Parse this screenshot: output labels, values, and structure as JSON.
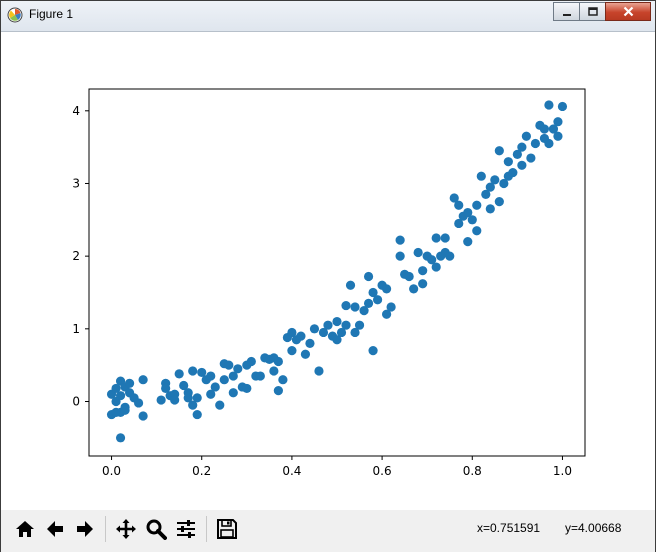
{
  "window": {
    "title": "Figure 1"
  },
  "toolbar": {
    "buttons": [
      "home-icon",
      "back-icon",
      "forward-icon",
      "pan-icon",
      "zoom-icon",
      "configure-subplots-icon",
      "save-icon"
    ],
    "coord_x": "x=0.751591",
    "coord_y": "y=4.00668"
  },
  "colors": {
    "marker": "#1f77b4",
    "axes": "#000000",
    "toolbar_bg": "#f0f0f0"
  },
  "chart_data": {
    "type": "scatter",
    "title": "",
    "xlabel": "",
    "ylabel": "",
    "xlim": [
      -0.05,
      1.05
    ],
    "ylim": [
      -0.75,
      4.3
    ],
    "xticks": [
      0.0,
      0.2,
      0.4,
      0.6,
      0.8,
      1.0
    ],
    "xtick_labels": [
      "0.0",
      "0.2",
      "0.4",
      "0.6",
      "0.8",
      "1.0"
    ],
    "yticks": [
      0,
      1,
      2,
      3,
      4
    ],
    "ytick_labels": [
      "0",
      "1",
      "2",
      "3",
      "4"
    ],
    "grid": false,
    "series": [
      {
        "points": [
          [
            0.0,
            0.1
          ],
          [
            0.01,
            0.0
          ],
          [
            0.01,
            0.18
          ],
          [
            0.02,
            0.28
          ],
          [
            0.02,
            0.08
          ],
          [
            0.0,
            -0.18
          ],
          [
            0.02,
            -0.15
          ],
          [
            0.03,
            0.2
          ],
          [
            0.03,
            -0.08
          ],
          [
            0.03,
            -0.12
          ],
          [
            0.04,
            0.25
          ],
          [
            0.04,
            0.12
          ],
          [
            0.05,
            0.05
          ],
          [
            0.06,
            -0.02
          ],
          [
            0.07,
            0.3
          ],
          [
            0.07,
            -0.2
          ],
          [
            0.02,
            -0.5
          ],
          [
            0.01,
            -0.15
          ],
          [
            0.11,
            0.02
          ],
          [
            0.12,
            0.25
          ],
          [
            0.12,
            0.18
          ],
          [
            0.13,
            0.08
          ],
          [
            0.14,
            0.1
          ],
          [
            0.14,
            0.02
          ],
          [
            0.15,
            0.38
          ],
          [
            0.16,
            0.22
          ],
          [
            0.17,
            0.05
          ],
          [
            0.17,
            0.12
          ],
          [
            0.18,
            -0.05
          ],
          [
            0.18,
            0.42
          ],
          [
            0.19,
            0.05
          ],
          [
            0.19,
            -0.18
          ],
          [
            0.2,
            0.4
          ],
          [
            0.21,
            0.3
          ],
          [
            0.22,
            0.35
          ],
          [
            0.22,
            0.1
          ],
          [
            0.23,
            0.2
          ],
          [
            0.24,
            -0.05
          ],
          [
            0.25,
            0.52
          ],
          [
            0.25,
            0.3
          ],
          [
            0.26,
            0.5
          ],
          [
            0.27,
            0.35
          ],
          [
            0.27,
            0.12
          ],
          [
            0.28,
            0.45
          ],
          [
            0.29,
            0.2
          ],
          [
            0.3,
            0.18
          ],
          [
            0.3,
            0.5
          ],
          [
            0.31,
            0.55
          ],
          [
            0.32,
            0.35
          ],
          [
            0.33,
            0.35
          ],
          [
            0.34,
            0.6
          ],
          [
            0.35,
            0.58
          ],
          [
            0.36,
            0.6
          ],
          [
            0.36,
            0.42
          ],
          [
            0.37,
            0.55
          ],
          [
            0.37,
            0.15
          ],
          [
            0.38,
            0.3
          ],
          [
            0.39,
            0.88
          ],
          [
            0.4,
            0.95
          ],
          [
            0.4,
            0.7
          ],
          [
            0.41,
            0.85
          ],
          [
            0.42,
            0.9
          ],
          [
            0.43,
            0.65
          ],
          [
            0.44,
            0.8
          ],
          [
            0.45,
            1.0
          ],
          [
            0.46,
            0.42
          ],
          [
            0.47,
            0.95
          ],
          [
            0.48,
            1.05
          ],
          [
            0.49,
            0.9
          ],
          [
            0.5,
            1.1
          ],
          [
            0.5,
            0.85
          ],
          [
            0.51,
            0.95
          ],
          [
            0.52,
            1.32
          ],
          [
            0.52,
            1.05
          ],
          [
            0.53,
            1.6
          ],
          [
            0.54,
            1.3
          ],
          [
            0.54,
            0.95
          ],
          [
            0.55,
            1.05
          ],
          [
            0.56,
            1.25
          ],
          [
            0.57,
            1.35
          ],
          [
            0.57,
            1.72
          ],
          [
            0.58,
            0.7
          ],
          [
            0.58,
            1.5
          ],
          [
            0.59,
            1.4
          ],
          [
            0.6,
            1.6
          ],
          [
            0.61,
            1.55
          ],
          [
            0.61,
            1.2
          ],
          [
            0.62,
            1.3
          ],
          [
            0.64,
            2.22
          ],
          [
            0.64,
            2.0
          ],
          [
            0.65,
            1.75
          ],
          [
            0.66,
            1.72
          ],
          [
            0.67,
            1.55
          ],
          [
            0.68,
            2.05
          ],
          [
            0.69,
            1.8
          ],
          [
            0.69,
            1.62
          ],
          [
            0.7,
            2.0
          ],
          [
            0.71,
            1.95
          ],
          [
            0.72,
            1.85
          ],
          [
            0.72,
            2.25
          ],
          [
            0.73,
            2.0
          ],
          [
            0.74,
            2.05
          ],
          [
            0.74,
            2.25
          ],
          [
            0.75,
            2.0
          ],
          [
            0.76,
            2.8
          ],
          [
            0.77,
            2.45
          ],
          [
            0.77,
            2.7
          ],
          [
            0.78,
            2.55
          ],
          [
            0.79,
            2.2
          ],
          [
            0.79,
            2.6
          ],
          [
            0.8,
            2.5
          ],
          [
            0.81,
            2.7
          ],
          [
            0.81,
            2.35
          ],
          [
            0.82,
            3.1
          ],
          [
            0.83,
            2.85
          ],
          [
            0.84,
            2.95
          ],
          [
            0.84,
            2.65
          ],
          [
            0.85,
            3.05
          ],
          [
            0.86,
            3.45
          ],
          [
            0.86,
            2.75
          ],
          [
            0.87,
            3.0
          ],
          [
            0.88,
            3.3
          ],
          [
            0.88,
            3.1
          ],
          [
            0.89,
            3.15
          ],
          [
            0.9,
            3.4
          ],
          [
            0.91,
            3.5
          ],
          [
            0.91,
            3.25
          ],
          [
            0.92,
            3.65
          ],
          [
            0.93,
            3.35
          ],
          [
            0.94,
            3.55
          ],
          [
            0.95,
            3.8
          ],
          [
            0.96,
            3.75
          ],
          [
            0.96,
            3.62
          ],
          [
            0.97,
            4.08
          ],
          [
            0.97,
            3.55
          ],
          [
            0.98,
            3.75
          ],
          [
            0.99,
            3.85
          ],
          [
            0.99,
            3.65
          ],
          [
            1.0,
            4.06
          ]
        ]
      }
    ]
  }
}
